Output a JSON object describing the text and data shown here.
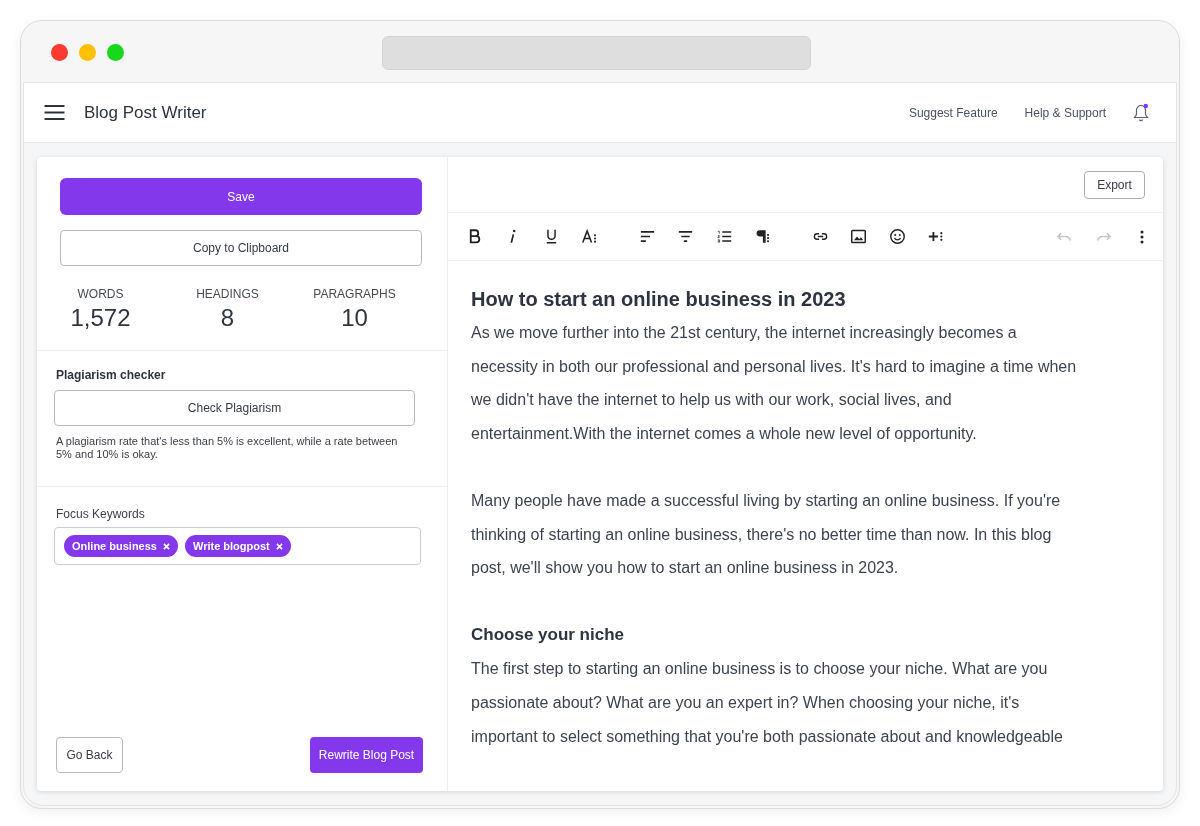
{
  "header": {
    "title": "Blog Post Writer",
    "links": [
      "Suggest Feature",
      "Help & Support"
    ],
    "notifications": {
      "unread": true
    }
  },
  "sidebar": {
    "save_button": "Save",
    "copy_button": "Copy to Clipboard",
    "stats": [
      {
        "label": "WORDS",
        "value": "1,572"
      },
      {
        "label": "HEADINGS",
        "value": "8"
      },
      {
        "label": "PARAGRAPHS",
        "value": "10"
      }
    ],
    "plagiarism": {
      "title": "Plagiarism checker",
      "button": "Check Plagiarism",
      "note": "A plagiarism rate that's less than 5% is excellent, while a rate between 5% and 10% is okay."
    },
    "focus_keywords": {
      "label": "Focus Keywords",
      "keywords": [
        "Online business",
        "Write blogpost"
      ]
    },
    "back_button": "Go Back",
    "rewrite_button": "Rewrite Blog Post"
  },
  "editor": {
    "export_button": "Export",
    "undo": {
      "disabled": true
    },
    "redo": {
      "disabled": true
    },
    "content": [
      {
        "kind": "title",
        "text": "How to start an online business in 2023"
      },
      {
        "kind": "paragraph",
        "lines": [
          "As we move further into the 21st century, the internet increasingly becomes a",
          "necessity in both our professional and personal lives. It's hard to imagine a time when",
          "we didn't have the internet to help us with our work, social lives, and",
          "entertainment.With the internet comes a whole new level of opportunity."
        ]
      },
      {
        "kind": "paragraph",
        "lines": [
          "Many people have made a successful living by starting an online business. If you're",
          "thinking of starting an online business, there's no better time than now. In this blog",
          "post, we'll show you how to start an online business in 2023."
        ]
      },
      {
        "kind": "heading",
        "text": "Choose your niche"
      },
      {
        "kind": "paragraph",
        "lines": [
          "The first step to starting an online business is to choose your niche. What are you",
          "passionate about? What are you an expert in? When choosing your niche, it's",
          "important to select something that you're both passionate about and knowledgeable"
        ]
      }
    ]
  }
}
